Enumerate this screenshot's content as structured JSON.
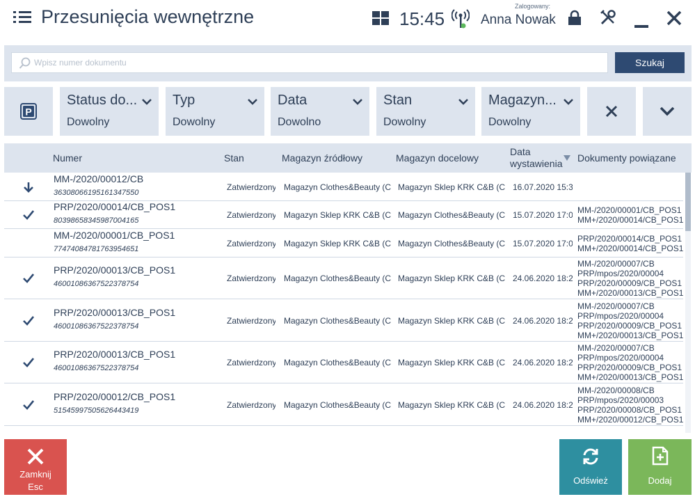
{
  "header": {
    "title": "Przesunięcia wewnętrzne",
    "time": "15:45",
    "logged_label": "Zalogowany:",
    "user": "Anna Nowak"
  },
  "search": {
    "placeholder": "Wpisz numer dokumentu",
    "button": "Szukaj"
  },
  "filters": [
    {
      "label": "Status do...",
      "value": "Dowolny"
    },
    {
      "label": "Typ",
      "value": "Dowolny"
    },
    {
      "label": "Data",
      "value": "Dowolno"
    },
    {
      "label": "Stan",
      "value": "Dowolny"
    },
    {
      "label": "Magazyn...",
      "value": "Dowolny"
    }
  ],
  "table": {
    "columns": [
      "Numer",
      "Stan",
      "Magazyn źródłowy",
      "Magazyn docelowy",
      "Data",
      "wystawienia",
      "Dokumenty powiązane"
    ],
    "rows": [
      {
        "mark": "arrow",
        "number": "MM-/2020/00012/CB",
        "code": "36308066195161347550",
        "status": "Zatwierdzony",
        "source": "Magazyn Clothes&Beauty (C",
        "target": "Magazyn Sklep KRK C&B (CE",
        "date": "16.07.2020 15:3",
        "docs": []
      },
      {
        "mark": "check",
        "number": "PRP/2020/00014/CB_POS1",
        "code": "80398658345987004165",
        "status": "Zatwierdzony",
        "source": "Magazyn Sklep KRK C&B (CE",
        "target": "Magazyn Clothes&Beauty (C",
        "date": "15.07.2020 17:0",
        "docs": [
          "MM-/2020/00001/CB_POS1",
          "MM+/2020/00014/CB_POS1"
        ]
      },
      {
        "mark": "none",
        "number": "MM-/2020/00001/CB_POS1",
        "code": "77474084781763954651",
        "status": "Zatwierdzony",
        "source": "Magazyn Sklep KRK C&B (CE",
        "target": "Magazyn Clothes&Beauty (C",
        "date": "15.07.2020 17:0",
        "docs": [
          "PRP/2020/00014/CB_POS1",
          "MM+/2020/00014/CB_POS1"
        ]
      },
      {
        "mark": "check",
        "number": "PRP/2020/00013/CB_POS1",
        "code": "46001086367522378754",
        "status": "Zatwierdzony",
        "source": "Magazyn Clothes&Beauty (C",
        "target": "Magazyn Sklep KRK C&B (CE",
        "date": "24.06.2020 18:2",
        "docs": [
          "MM-/2020/00007/CB",
          "PRP/mpos/2020/00004",
          "PRP/2020/00009/CB_POS1",
          "MM+/2020/00013/CB_POS1"
        ]
      },
      {
        "mark": "check",
        "number": "PRP/2020/00013/CB_POS1",
        "code": "46001086367522378754",
        "status": "Zatwierdzony",
        "source": "Magazyn Clothes&Beauty (C",
        "target": "Magazyn Sklep KRK C&B (CE",
        "date": "24.06.2020 18:2",
        "docs": [
          "MM-/2020/00007/CB",
          "PRP/mpos/2020/00004",
          "PRP/2020/00009/CB_POS1",
          "MM+/2020/00013/CB_POS1"
        ]
      },
      {
        "mark": "check",
        "number": "PRP/2020/00013/CB_POS1",
        "code": "46001086367522378754",
        "status": "Zatwierdzony",
        "source": "Magazyn Clothes&Beauty (C",
        "target": "Magazyn Sklep KRK C&B (CE",
        "date": "24.06.2020 18:2",
        "docs": [
          "MM-/2020/00007/CB",
          "PRP/mpos/2020/00004",
          "PRP/2020/00009/CB_POS1",
          "MM+/2020/00013/CB_POS1"
        ]
      },
      {
        "mark": "check",
        "number": "PRP/2020/00012/CB_POS1",
        "code": "51545997505626443419",
        "status": "Zatwierdzony",
        "source": "Magazyn Clothes&Beauty (C",
        "target": "Magazyn Sklep KRK C&B (CE",
        "date": "24.06.2020 18:2",
        "docs": [
          "MM-/2020/00008/CB",
          "PRP/mpos/2020/00003",
          "PRP/2020/00008/CB_POS1",
          "MM+/2020/00012/CB_POS1"
        ]
      },
      {
        "mark": "none",
        "number": "",
        "code": "",
        "status": "",
        "source": "",
        "target": "",
        "date": "",
        "docs": [
          "MM-/2020/00008/CB"
        ]
      }
    ]
  },
  "buttons": {
    "close": "Zamknij",
    "close_key": "Esc",
    "refresh": "Odśwież",
    "add": "Dodaj"
  },
  "colors": {
    "text": "#2e3f57",
    "panel": "#dde4ee",
    "search_button": "#2e4a72",
    "close_button": "#d9534f",
    "refresh_button": "#2e8fa0",
    "add_button": "#7bb75a"
  }
}
